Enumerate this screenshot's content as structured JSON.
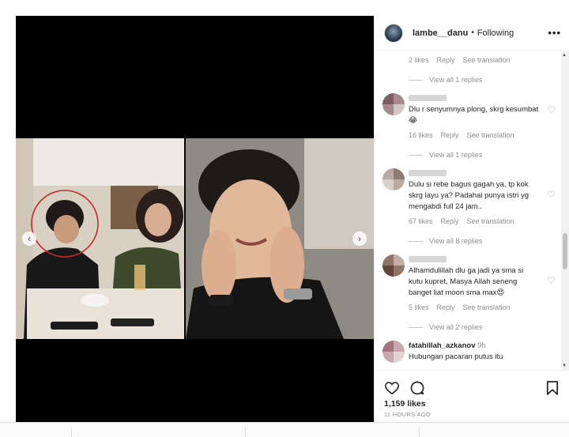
{
  "post": {
    "username": "lambe__danu",
    "separator": "•",
    "follow_status": "Following",
    "more_glyph": "•••",
    "likes": "1,159 likes",
    "posted": "11 HOURS AGO"
  },
  "comments": {
    "top_meta": {
      "likes": "2 likes",
      "reply": "Reply",
      "translate": "See translation"
    },
    "top_view": "View all 1 replies",
    "items": [
      {
        "text": "Dlu r senyumnya plong, skrg kesumbat😂",
        "likes": "16 likes",
        "reply": "Reply",
        "translate": "See translation",
        "view": "View all 1 replies"
      },
      {
        "text": "Dulu si rebe bagus gagah ya, tp kok skrg layu ya? Padahai punya istri yg mengabdi full 24 jam..",
        "likes": "67 likes",
        "reply": "Reply",
        "translate": "See translation",
        "view": "View all 8 replies"
      },
      {
        "text": "Alhamdulillah dlu ga jadi ya sma si kutu kupret, Masya Allah seneng banget liat moon sma max😍",
        "likes": "5 likes",
        "reply": "Reply",
        "translate": "See translation",
        "view": "View all 2 replies"
      }
    ],
    "last": {
      "name": "fatahillah_azkanov",
      "time": "9h",
      "text": "Hubungan pacaran putus itu"
    }
  },
  "icons": {
    "heart": "♡",
    "prev": "‹",
    "next": "›",
    "scroll_up": "▲",
    "scroll_down": "▼"
  }
}
